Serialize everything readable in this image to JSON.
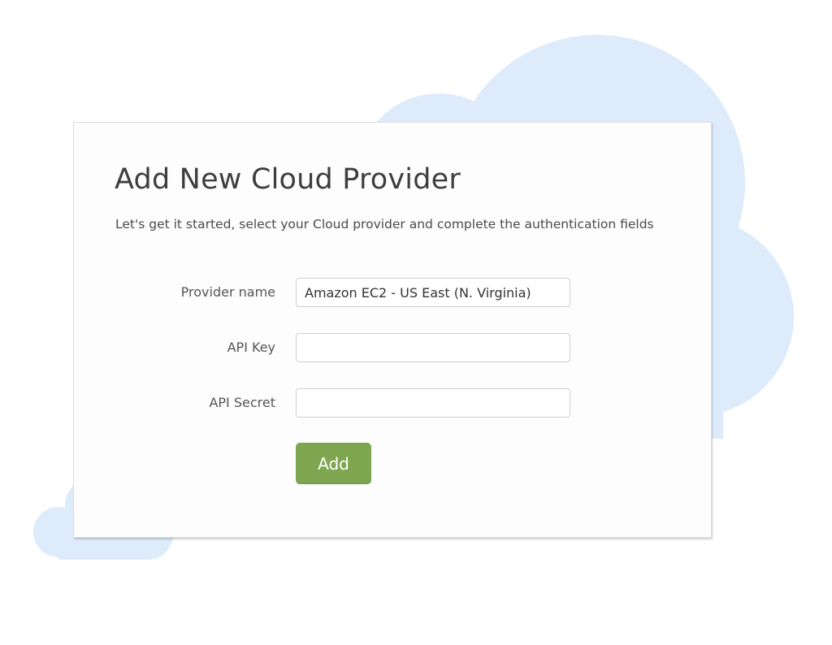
{
  "colors": {
    "cloud": "#ddebfb",
    "accent_button": "#7ea650",
    "card_background": "#fdfdfd",
    "title_text": "#3e3e3e"
  },
  "dialog": {
    "title": "Add New Cloud Provider",
    "subtitle": "Let's get it started, select your Cloud provider and complete the authentication fields"
  },
  "form": {
    "provider_name": {
      "label": "Provider name",
      "value": "Amazon EC2 - US East (N. Virginia)"
    },
    "api_key": {
      "label": "API Key",
      "value": ""
    },
    "api_secret": {
      "label": "API Secret",
      "value": ""
    },
    "add_label": "Add"
  }
}
